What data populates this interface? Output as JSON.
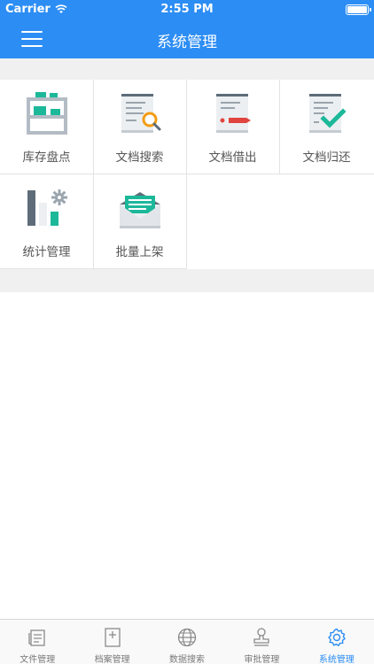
{
  "status_bar": {
    "carrier": "Carrier",
    "time": "2:55 PM"
  },
  "nav": {
    "title": "系统管理"
  },
  "grid": {
    "items": [
      {
        "label": "库存盘点",
        "icon": "inventory-shelf-icon"
      },
      {
        "label": "文档搜索",
        "icon": "document-search-icon"
      },
      {
        "label": "文档借出",
        "icon": "document-lend-icon"
      },
      {
        "label": "文档归还",
        "icon": "document-return-icon"
      },
      {
        "label": "统计管理",
        "icon": "statistics-icon"
      },
      {
        "label": "批量上架",
        "icon": "batch-shelve-icon"
      }
    ]
  },
  "tab_bar": {
    "items": [
      {
        "label": "文件管理",
        "icon": "file-icon",
        "active": false
      },
      {
        "label": "档案管理",
        "icon": "archive-icon",
        "active": false
      },
      {
        "label": "数据搜索",
        "icon": "globe-icon",
        "active": false
      },
      {
        "label": "审批管理",
        "icon": "stamp-icon",
        "active": false
      },
      {
        "label": "系统管理",
        "icon": "gear-icon",
        "active": true
      }
    ]
  },
  "colors": {
    "accent": "#2c8df4",
    "teal": "#1cb89a",
    "red": "#e0443e"
  }
}
